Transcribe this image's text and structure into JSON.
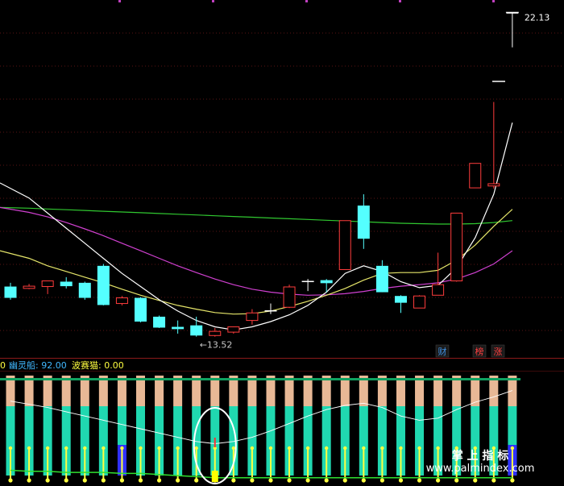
{
  "chart_data": {
    "type": "candlestick",
    "price_labels": {
      "high_label": "22.13",
      "low_label": "←13.52"
    },
    "price_range": [
      13.0,
      22.5
    ],
    "candles": [
      {
        "o": 14.55,
        "h": 14.95,
        "l": 14.5,
        "c": 14.85,
        "color": "cyan"
      },
      {
        "o": 14.8,
        "h": 14.92,
        "l": 14.78,
        "c": 14.86,
        "color": "red"
      },
      {
        "o": 14.85,
        "h": 15.0,
        "l": 14.65,
        "c": 15.0,
        "color": "red"
      },
      {
        "o": 14.98,
        "h": 15.1,
        "l": 14.8,
        "c": 14.86,
        "color": "cyan"
      },
      {
        "o": 14.95,
        "h": 14.98,
        "l": 14.5,
        "c": 14.55,
        "color": "cyan"
      },
      {
        "o": 15.4,
        "h": 15.45,
        "l": 14.35,
        "c": 14.36,
        "color": "cyan"
      },
      {
        "o": 14.4,
        "h": 14.6,
        "l": 14.35,
        "c": 14.55,
        "color": "red"
      },
      {
        "o": 14.55,
        "h": 14.57,
        "l": 13.9,
        "c": 13.92,
        "color": "cyan"
      },
      {
        "o": 14.05,
        "h": 14.08,
        "l": 13.75,
        "c": 13.76,
        "color": "cyan"
      },
      {
        "o": 13.78,
        "h": 13.95,
        "l": 13.6,
        "c": 13.72,
        "color": "cyan"
      },
      {
        "o": 13.82,
        "h": 14.05,
        "l": 13.52,
        "c": 13.55,
        "color": "cyan"
      },
      {
        "o": 13.55,
        "h": 13.75,
        "l": 13.52,
        "c": 13.66,
        "color": "red"
      },
      {
        "o": 13.64,
        "h": 13.78,
        "l": 13.6,
        "c": 13.78,
        "color": "red"
      },
      {
        "o": 13.95,
        "h": 14.25,
        "l": 13.84,
        "c": 14.15,
        "color": "red"
      },
      {
        "o": 14.2,
        "h": 14.4,
        "l": 14.12,
        "c": 14.22,
        "color": "white"
      },
      {
        "o": 14.3,
        "h": 14.9,
        "l": 14.28,
        "c": 14.84,
        "color": "red"
      },
      {
        "o": 15.0,
        "h": 15.05,
        "l": 14.73,
        "c": 15.0,
        "color": "white"
      },
      {
        "o": 15.02,
        "h": 15.05,
        "l": 14.7,
        "c": 14.94,
        "color": "cyan"
      },
      {
        "o": 15.3,
        "h": 16.6,
        "l": 15.3,
        "c": 16.6,
        "color": "red"
      },
      {
        "o": 17.0,
        "h": 17.3,
        "l": 15.85,
        "c": 16.12,
        "color": "cyan"
      },
      {
        "o": 15.4,
        "h": 15.55,
        "l": 14.7,
        "c": 14.7,
        "color": "cyan"
      },
      {
        "o": 14.6,
        "h": 14.62,
        "l": 14.15,
        "c": 14.42,
        "color": "cyan"
      },
      {
        "o": 14.28,
        "h": 14.62,
        "l": 14.28,
        "c": 14.6,
        "color": "red"
      },
      {
        "o": 14.62,
        "h": 15.75,
        "l": 14.62,
        "c": 14.9,
        "color": "red"
      },
      {
        "o": 15.0,
        "h": 16.8,
        "l": 14.98,
        "c": 16.8,
        "color": "red"
      },
      {
        "o": 17.47,
        "h": 18.12,
        "l": 17.47,
        "c": 18.12,
        "color": "red"
      },
      {
        "o": 17.52,
        "h": 19.75,
        "l": 17.45,
        "c": 17.58,
        "color": "red"
      },
      {
        "o": 22.13,
        "h": 22.13,
        "l": 21.2,
        "c": 22.13,
        "color": "white"
      }
    ],
    "ma_lines": {
      "yellow": [
        15.8,
        15.6,
        15.4,
        15.25,
        15.1,
        14.95,
        14.78,
        14.62,
        14.48,
        14.35,
        14.25,
        14.16,
        14.12,
        14.13,
        14.2,
        14.32,
        14.46,
        14.62,
        14.8,
        15.02,
        15.2,
        15.22,
        15.22,
        15.28,
        15.55,
        15.95,
        16.45,
        16.9
      ],
      "magenta": [
        16.95,
        16.82,
        16.7,
        16.55,
        16.38,
        16.2,
        16.0,
        15.8,
        15.6,
        15.4,
        15.22,
        15.05,
        14.9,
        14.78,
        14.7,
        14.65,
        14.62,
        14.63,
        14.66,
        14.72,
        14.8,
        14.86,
        14.9,
        14.95,
        15.05,
        15.22,
        15.45,
        15.8
      ],
      "green": [
        16.95,
        16.93,
        16.91,
        16.89,
        16.87,
        16.85,
        16.83,
        16.81,
        16.79,
        16.77,
        16.75,
        16.73,
        16.71,
        16.69,
        16.67,
        16.65,
        16.63,
        16.61,
        16.59,
        16.57,
        16.55,
        16.53,
        16.52,
        16.51,
        16.51,
        16.52,
        16.55,
        16.6
      ],
      "white": [
        17.6,
        17.2,
        16.8,
        16.4,
        16.0,
        15.6,
        15.2,
        14.85,
        14.5,
        14.2,
        13.95,
        13.78,
        13.7,
        13.78,
        13.92,
        14.1,
        14.35,
        14.7,
        15.2,
        15.4,
        15.25,
        14.98,
        14.82,
        14.88,
        15.35,
        16.15,
        17.3,
        19.2
      ]
    },
    "badges": [
      {
        "label": "财",
        "color": "#3e8fe0"
      },
      {
        "label": "榜",
        "color": "#ff4040"
      },
      {
        "label": "涨",
        "color": "#ff4040"
      }
    ],
    "indicator": {
      "prefix": "0",
      "series": [
        {
          "name": "幽灵船",
          "value": "92.00",
          "color": "#40b8ff"
        },
        {
          "name": "波赛猫",
          "value": "0.00",
          "color": "#ffff40"
        }
      ],
      "white_line": [
        0.76,
        0.73,
        0.7,
        0.66,
        0.62,
        0.58,
        0.54,
        0.5,
        0.46,
        0.42,
        0.38,
        0.36,
        0.38,
        0.42,
        0.48,
        0.55,
        0.62,
        0.68,
        0.72,
        0.74,
        0.7,
        0.62,
        0.58,
        0.6,
        0.68,
        0.75,
        0.8,
        0.86
      ],
      "green_line": [
        0.11,
        0.1,
        0.1,
        0.09,
        0.09,
        0.09,
        0.08,
        0.08,
        0.07,
        0.06,
        0.05,
        0.04,
        0.04,
        0.04,
        0.04,
        0.04,
        0.04,
        0.04,
        0.04,
        0.04,
        0.04,
        0.04,
        0.04,
        0.04,
        0.04,
        0.04,
        0.04,
        0.04
      ],
      "special_bar_index": 6,
      "highlight_index": 11
    },
    "watermark": {
      "cn": "掌 上 指 标",
      "url": "www.palmindex.com"
    }
  }
}
